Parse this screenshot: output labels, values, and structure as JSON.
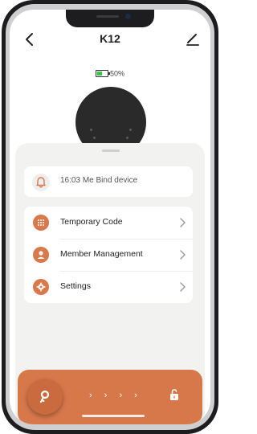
{
  "header": {
    "title": "K12"
  },
  "battery": {
    "percent_text": "50%",
    "level": 0.5,
    "color": "#2ecc40"
  },
  "notice": {
    "time": "16:03",
    "user": "Me",
    "message": "Bind device"
  },
  "menu": {
    "items": [
      {
        "label": "Temporary Code",
        "icon": "grid-icon"
      },
      {
        "label": "Member Management",
        "icon": "person-icon"
      },
      {
        "label": "Settings",
        "icon": "gear-icon"
      }
    ]
  },
  "action_bar": {
    "swipe_hint": "› › › ›",
    "key_icon": "key-icon",
    "unlock_icon": "unlock-icon"
  },
  "colors": {
    "accent": "#d7784b",
    "device": "#2a2a2a"
  }
}
